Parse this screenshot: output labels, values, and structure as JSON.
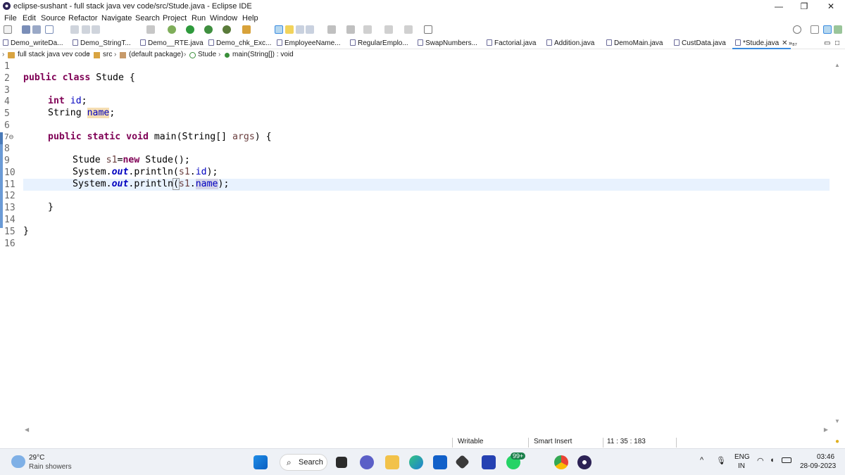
{
  "window": {
    "title": "eclipse-sushant - full stack java vev code/src/Stude.java - Eclipse IDE",
    "controls": {
      "minimize": "—",
      "restore": "❐",
      "close": "✕"
    }
  },
  "menu": [
    "File",
    "Edit",
    "Source",
    "Refactor",
    "Navigate",
    "Search",
    "Project",
    "Run",
    "Window",
    "Help"
  ],
  "tabs": [
    {
      "label": "Demo_writeDa..."
    },
    {
      "label": "Demo_StringT..."
    },
    {
      "label": "Demo__RTE.java"
    },
    {
      "label": "Demo_chk_Exc..."
    },
    {
      "label": "EmployeeName..."
    },
    {
      "label": "RegularEmplo..."
    },
    {
      "label": "SwapNumbers..."
    },
    {
      "label": "Factorial.java"
    },
    {
      "label": "Addition.java"
    },
    {
      "label": "DemoMain.java"
    },
    {
      "label": "CustData.java"
    },
    {
      "label": "*Stude.java",
      "active": true
    }
  ],
  "tab_overflow": "»₈₇",
  "breadcrumb": {
    "project": "full stack java vev code",
    "src": "src",
    "package": "(default package)",
    "class": "Stude",
    "method": "main(String[]) : void"
  },
  "editor": {
    "line_numbers": [
      "1",
      "2",
      "3",
      "4",
      "5",
      "6",
      "7⊖",
      "8",
      "9",
      "10",
      "11",
      "12",
      "13",
      "14",
      "15",
      "16"
    ],
    "lines": {
      "l2_kw": "public class",
      "l2_rest": " Stude {",
      "l4_kw": "int",
      "l4_fld": "id",
      "l5_type": "String ",
      "l5_fld": "name",
      "l7_kw": "public static void",
      "l7_mid": " main(String[] ",
      "l7_var": "args",
      "l7_end": ") {",
      "l9_a": "Stude ",
      "l9_var": "s1",
      "l9_eq": "=",
      "l9_kw": "new",
      "l9_end": " Stude();",
      "l10_a": "System.",
      "l10_out": "out",
      "l10_b": ".println(",
      "l10_var": "s1",
      "l10_dot": ".",
      "l10_fld": "id",
      "l10_end": ");",
      "l11_a": "System.",
      "l11_out": "out",
      "l11_b": ".println",
      "l11_paren": "(",
      "l11_var": "s1",
      "l11_dot": ".",
      "l11_fld": "name",
      "l11_end": ");",
      "l13": "}",
      "l15": "}"
    }
  },
  "status": {
    "writable": "Writable",
    "insert_mode": "Smart Insert",
    "position": "11 : 35 : 183"
  },
  "taskbar": {
    "weather_temp": "29°C",
    "weather_desc": "Rain showers",
    "search_label": "Search",
    "badge": "99+",
    "lang_top": "ENG",
    "lang_bottom": "IN",
    "time": "03:46",
    "date": "28-09-2023"
  },
  "colors": {
    "keyword": "#7f0055",
    "field": "#0000c0",
    "local_var": "#6a3e3e",
    "current_line": "#e8f2fe",
    "occurrence_highlight": "#f5deb3"
  }
}
